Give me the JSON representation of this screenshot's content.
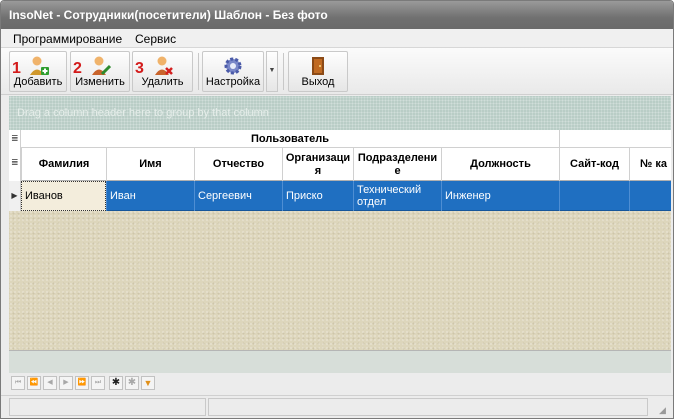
{
  "window": {
    "title": "InsoNet - Сотрудники(посетители) Шаблон - Без фото"
  },
  "menu": {
    "items": [
      "Программирование",
      "Сервис"
    ]
  },
  "toolbar": {
    "add": {
      "label": "Добавить",
      "number": "1"
    },
    "edit": {
      "label": "Изменить",
      "number": "2"
    },
    "delete": {
      "label": "Удалить",
      "number": "3"
    },
    "settings": {
      "label": "Настройка"
    },
    "exit": {
      "label": "Выход"
    }
  },
  "group_panel": {
    "hint": "Drag a column header here to group by that column"
  },
  "grid": {
    "band_title": "Пользователь",
    "columns": [
      "Фамилия",
      "Имя",
      "Отчество",
      "Организация",
      "Подразделение",
      "Должность",
      "Сайт-код",
      "№ ка"
    ],
    "rows": [
      [
        "Иванов",
        "Иван",
        "Сергеевич",
        "Приско",
        "Технический отдел",
        "Инженер",
        "",
        ""
      ]
    ]
  },
  "colors": {
    "selection": "#1f6fc1",
    "accent_number": "#d31b1b",
    "grid_background": "#ddd6bc",
    "group_panel": "#b9cdc6"
  }
}
